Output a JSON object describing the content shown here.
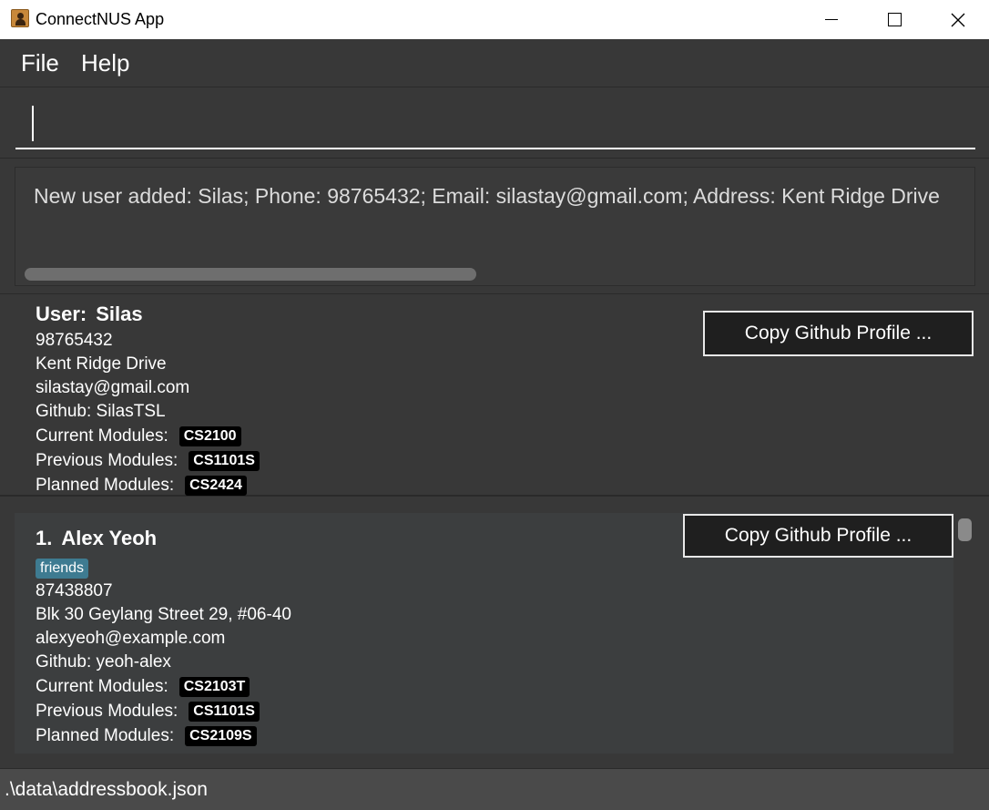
{
  "window": {
    "title": "ConnectNUS App",
    "close_glyph": "✕"
  },
  "menu": {
    "file": "File",
    "help": "Help"
  },
  "command": {
    "value": "",
    "placeholder": ""
  },
  "result": {
    "text": "New user added: Silas; Phone: 98765432; Email: silastay@gmail.com; Address: Kent Ridge Drive"
  },
  "user": {
    "heading_prefix": "User:",
    "name": "Silas",
    "phone": "98765432",
    "address": "Kent Ridge Drive",
    "email": "silastay@gmail.com",
    "github": "Github: SilasTSL",
    "current_modules_label": "Current Modules:",
    "current_modules": "CS2100",
    "previous_modules_label": "Previous Modules:",
    "previous_modules": "CS1101S",
    "planned_modules_label": "Planned Modules:",
    "planned_modules": "CS2424",
    "copy_button": "Copy Github Profile ..."
  },
  "contacts": [
    {
      "index": "1.",
      "name": "Alex Yeoh",
      "tag": "friends",
      "phone": "87438807",
      "address": "Blk 30 Geylang Street 29, #06-40",
      "email": "alexyeoh@example.com",
      "github": "Github: yeoh-alex",
      "current_modules_label": "Current Modules:",
      "current_modules": "CS2103T",
      "previous_modules_label": "Previous Modules:",
      "previous_modules": "CS1101S",
      "planned_modules_label": "Planned Modules:",
      "planned_modules": "CS2109S",
      "copy_button": "Copy Github Profile ..."
    }
  ],
  "status": {
    "path": ".\\data\\addressbook.json"
  },
  "icons": {
    "app": "user-contact-icon",
    "minimize": "minimize-icon",
    "maximize": "maximize-icon",
    "close": "close-icon"
  },
  "colors": {
    "background": "#383838",
    "tag_friend": "#3e7b91",
    "tag_module": "#000000",
    "selection_mark": "#d02020"
  }
}
